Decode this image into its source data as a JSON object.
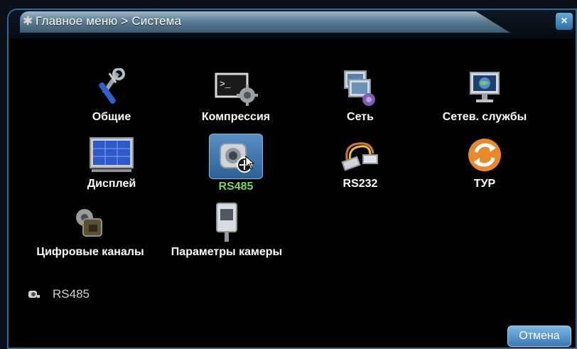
{
  "header": {
    "title": "Главное меню > Система",
    "close_glyph": "×"
  },
  "menu": {
    "items": [
      {
        "label": "Общие",
        "icon": "tools-icon"
      },
      {
        "label": "Компрессия",
        "icon": "terminal-gear-icon"
      },
      {
        "label": "Сеть",
        "icon": "network-monitors-icon"
      },
      {
        "label": "Сетев. службы",
        "icon": "globe-monitor-icon"
      },
      {
        "label": "Дисплей",
        "icon": "display-icon"
      },
      {
        "label": "RS485",
        "icon": "ptz-camera-icon",
        "selected": true
      },
      {
        "label": "RS232",
        "icon": "cable-icon"
      },
      {
        "label": "ТУР",
        "icon": "refresh-icon"
      },
      {
        "label": "Цифровые каналы",
        "icon": "digital-channel-icon"
      },
      {
        "label": "Параметры камеры",
        "icon": "camera-icon"
      }
    ]
  },
  "status": {
    "text": "RS485"
  },
  "footer": {
    "cancel_label": "Отмена"
  },
  "colors": {
    "accent": "#2a6d97",
    "selected_label": "#7ed15a",
    "background": "#000000"
  }
}
